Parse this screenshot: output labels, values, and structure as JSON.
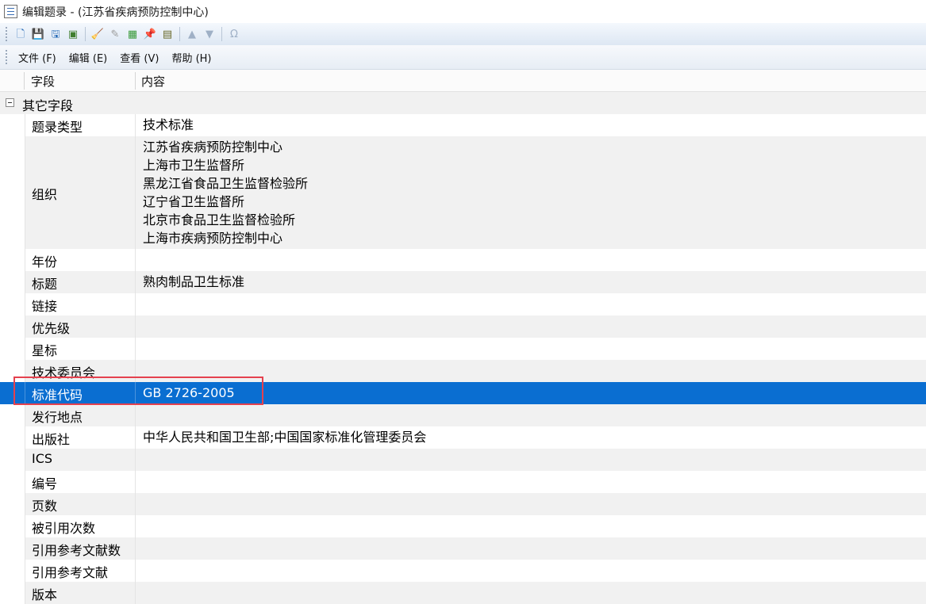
{
  "window": {
    "title": "编辑题录 - (江苏省疾病预防控制中心)",
    "icon": "list-document-icon"
  },
  "toolbar": {
    "buttons": [
      {
        "name": "new-record-icon",
        "glyph": "🗋"
      },
      {
        "name": "save-icon",
        "glyph": "💾"
      },
      {
        "name": "save-all-icon",
        "glyph": "🖫"
      },
      {
        "name": "export-icon",
        "glyph": "▣"
      },
      {
        "name": "clean-icon",
        "glyph": "🧹"
      },
      {
        "name": "clean-disabled-icon",
        "glyph": "✎"
      },
      {
        "name": "grid-icon",
        "glyph": "▦"
      },
      {
        "name": "pin-icon",
        "glyph": "📌"
      },
      {
        "name": "import-icon",
        "glyph": "▤"
      },
      {
        "name": "move-up-icon",
        "glyph": "▲"
      },
      {
        "name": "move-down-icon",
        "glyph": "▼"
      },
      {
        "name": "omega-icon",
        "glyph": "Ω"
      }
    ]
  },
  "menu": [
    "文件 (F)",
    "编辑 (E)",
    "查看 (V)",
    "帮助 (H)"
  ],
  "grid": {
    "headers": {
      "field": "字段",
      "content": "内容"
    },
    "group": "其它字段",
    "rows": [
      {
        "name": "题录类型",
        "values": [
          "技术标准"
        ]
      },
      {
        "name": "组织",
        "values": [
          "江苏省疾病预防控制中心",
          "上海市卫生监督所",
          "黑龙江省食品卫生监督检验所",
          "辽宁省卫生监督所",
          "北京市食品卫生监督检验所",
          "上海市疾病预防控制中心"
        ]
      },
      {
        "name": "年份",
        "values": []
      },
      {
        "name": "标题",
        "values": [
          "熟肉制品卫生标准"
        ]
      },
      {
        "name": "链接",
        "values": []
      },
      {
        "name": "优先级",
        "values": []
      },
      {
        "name": "星标",
        "values": []
      },
      {
        "name": "技术委员会",
        "values": []
      },
      {
        "name": "标准代码",
        "values": [
          "GB 2726-2005"
        ],
        "selected": true
      },
      {
        "name": "发行地点",
        "values": []
      },
      {
        "name": "出版社",
        "values": [
          "中华人民共和国卫生部;中国国家标准化管理委员会"
        ]
      },
      {
        "name": "ICS",
        "values": []
      },
      {
        "name": "编号",
        "values": []
      },
      {
        "name": "页数",
        "values": []
      },
      {
        "name": "被引用次数",
        "values": []
      },
      {
        "name": "引用参考文献数",
        "values": []
      },
      {
        "name": "引用参考文献",
        "values": []
      },
      {
        "name": "版本",
        "values": []
      }
    ]
  },
  "colors": {
    "selection": "#0a6ed1",
    "highlight_box": "#e5414e",
    "alt_row": "#f1f1f1"
  }
}
